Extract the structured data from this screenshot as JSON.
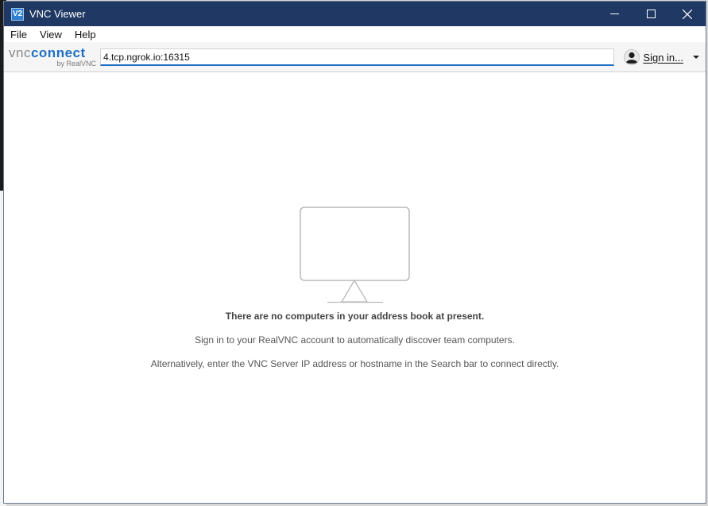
{
  "window": {
    "title": "VNC Viewer",
    "app_icon_text": "V2",
    "controls": [
      "minimize",
      "maximize",
      "close"
    ]
  },
  "menu": {
    "items": [
      "File",
      "View",
      "Help"
    ]
  },
  "toolbar": {
    "logo_main_vnc": "vnc",
    "logo_main_connect": "connect",
    "logo_sub": "by RealVNC",
    "search_value": "4.tcp.ngrok.io:16315",
    "signin_label": "Sign in..."
  },
  "empty_state": {
    "title": "There are no computers in your address book at present.",
    "line1": "Sign in to your RealVNC account to automatically discover team computers.",
    "line2": "Alternatively, enter the VNC Server IP address or hostname in the Search bar to connect directly."
  },
  "colors": {
    "titlebar": "#1f3864",
    "accent": "#1f6fc3"
  },
  "icons": {
    "app": "vnc-viewer-icon",
    "user": "user-icon",
    "dropdown": "chevron-down-icon",
    "placeholder": "monitor-icon"
  }
}
